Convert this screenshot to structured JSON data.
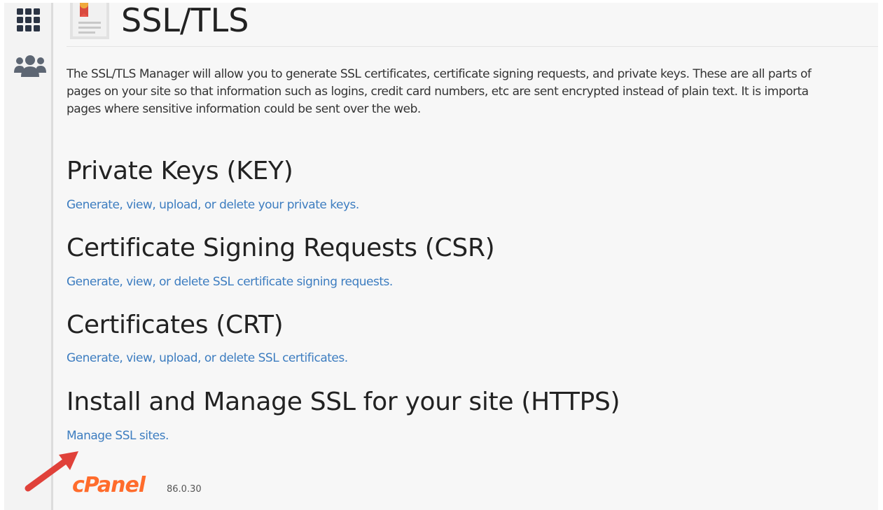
{
  "header": {
    "title": "SSL/TLS"
  },
  "description": {
    "line1": "The SSL/TLS Manager will allow you to generate SSL certificates, certificate signing requests, and private keys. These are all parts of",
    "line2": "pages on your site so that information such as logins, credit card numbers, etc are sent encrypted instead of plain text. It is importa",
    "line3": "pages where sensitive information could be sent over the web."
  },
  "sections": [
    {
      "heading": "Private Keys (KEY)",
      "link": "Generate, view, upload, or delete your private keys."
    },
    {
      "heading": "Certificate Signing Requests (CSR)",
      "link": "Generate, view, or delete SSL certificate signing requests."
    },
    {
      "heading": "Certificates (CRT)",
      "link": "Generate, view, upload, or delete SSL certificates."
    },
    {
      "heading": "Install and Manage SSL for your site (HTTPS)",
      "link": "Manage SSL sites."
    }
  ],
  "footer": {
    "logo": "cPanel",
    "version": "86.0.30"
  },
  "sidebar": {
    "icons": [
      "grid-icon",
      "users-icon"
    ]
  },
  "colors": {
    "link": "#3d7dc0",
    "brand": "#ff6c2c",
    "arrow": "#e0413a"
  }
}
